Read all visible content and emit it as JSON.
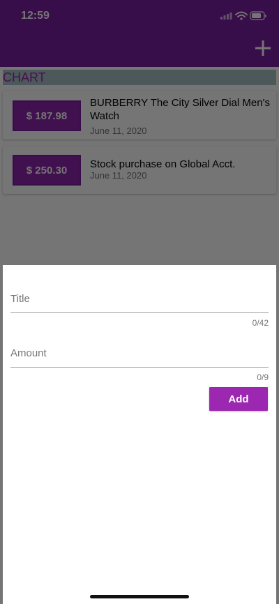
{
  "status_bar": {
    "time": "12:59",
    "icons": [
      "signal-icon",
      "wifi-icon",
      "battery-icon"
    ]
  },
  "app_bar": {
    "action_icon": "plus-icon",
    "color": "#7b1fa2"
  },
  "chart": {
    "label": "CHART"
  },
  "transactions": [
    {
      "amount": "$ 187.98",
      "title": "BURBERRY The City Silver Dial Men's Watch",
      "date": "June 11, 2020"
    },
    {
      "amount": "$ 250.30",
      "title": "Stock purchase on Global Acct.",
      "date": "June 11, 2020"
    }
  ],
  "sheet": {
    "title_field": {
      "placeholder": "Title",
      "value": "",
      "counter": "0/42"
    },
    "amount_field": {
      "placeholder": "Amount",
      "value": "",
      "counter": "0/9"
    },
    "add_button_label": "Add",
    "accent_color": "#9c27b0"
  }
}
